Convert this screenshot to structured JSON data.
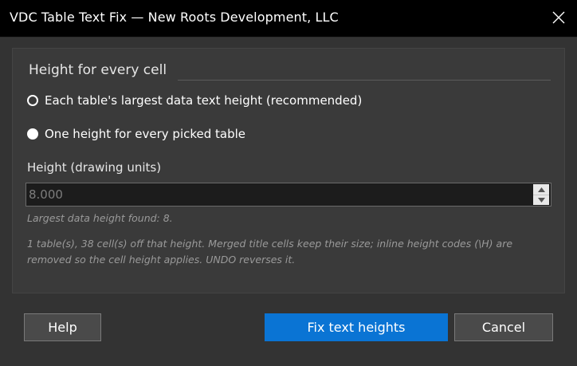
{
  "window": {
    "title": "VDC Table Text Fix — New Roots Development, LLC",
    "close_icon": "close-icon"
  },
  "group": {
    "title": "Height for every cell",
    "options": [
      {
        "label": "Each table's largest data text height (recommended)",
        "selected": false
      },
      {
        "label": "One height for every picked table",
        "selected": true
      }
    ]
  },
  "height_field": {
    "label": "Height (drawing units)",
    "value": "8.000",
    "spinner_icons": [
      "chevron-up-icon",
      "chevron-down-icon"
    ]
  },
  "notes": {
    "found": "Largest data height found: 8.",
    "description": "1 table(s), 38 cell(s) off that height. Merged title cells keep their size; inline height codes (\\H) are removed so the cell height applies. UNDO reverses it."
  },
  "buttons": {
    "help": "Help",
    "primary": "Fix text heights",
    "cancel": "Cancel"
  },
  "colors": {
    "accent": "#0a74d4",
    "background": "#333333",
    "titlebar": "#000000"
  }
}
